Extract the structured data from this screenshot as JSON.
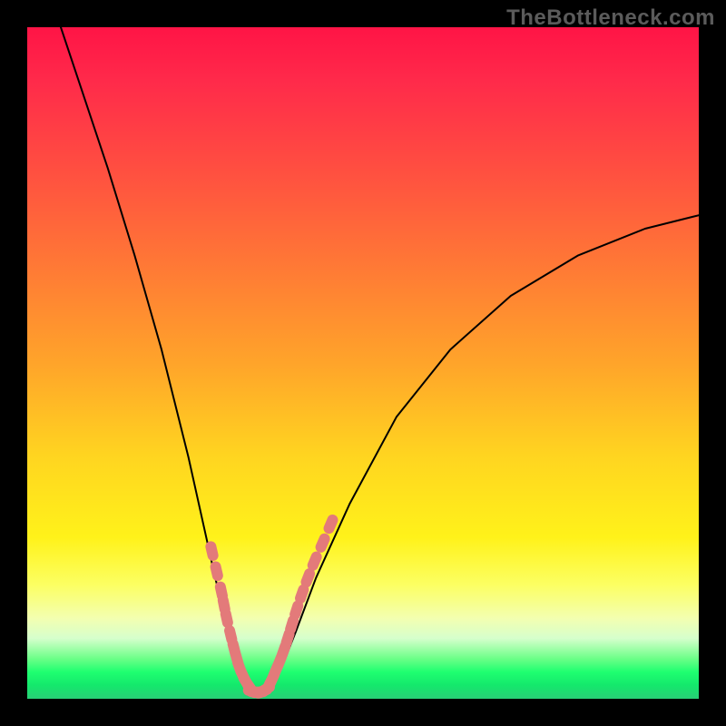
{
  "watermark": "TheBottleneck.com",
  "chart_data": {
    "type": "line",
    "title": "",
    "xlabel": "",
    "ylabel": "",
    "xlim": [
      0,
      100
    ],
    "ylim": [
      0,
      100
    ],
    "grid": false,
    "legend": false,
    "annotations": [],
    "series": [
      {
        "name": "curve",
        "color": "#000000",
        "x": [
          5,
          8,
          12,
          16,
          20,
          24,
          26,
          28,
          30,
          31,
          32,
          33,
          34,
          35,
          36,
          37,
          38,
          40,
          43,
          48,
          55,
          63,
          72,
          82,
          92,
          100
        ],
        "y": [
          100,
          91,
          79,
          66,
          52,
          36,
          27,
          18,
          10,
          6,
          3,
          1.5,
          1,
          1,
          1.5,
          3,
          5,
          10,
          18,
          29,
          42,
          52,
          60,
          66,
          70,
          72
        ]
      },
      {
        "name": "marker-band-left",
        "color": "#e37a7a",
        "type": "scatter",
        "x": [
          27.5,
          28.2,
          28.9,
          29.3,
          29.7,
          30.3,
          30.8,
          31.2,
          31.6,
          32.1,
          32.6,
          33.2
        ],
        "y": [
          22,
          19,
          16,
          14,
          12,
          9.5,
          7.5,
          6,
          4.7,
          3.5,
          2.5,
          1.6
        ]
      },
      {
        "name": "marker-band-right",
        "color": "#e37a7a",
        "type": "scatter",
        "x": [
          36.0,
          36.5,
          37.0,
          37.6,
          38.2,
          38.8,
          39.4,
          40.1,
          40.9,
          41.8,
          42.8,
          44.0,
          45.2
        ],
        "y": [
          2.0,
          3.0,
          4.2,
          5.6,
          7.2,
          9.0,
          11.0,
          13.2,
          15.6,
          18.0,
          20.5,
          23.2,
          26.0
        ]
      },
      {
        "name": "marker-band-bottom",
        "color": "#e37a7a",
        "type": "scatter",
        "x": [
          33.6,
          34.0,
          34.5,
          35.0,
          35.5
        ],
        "y": [
          1.1,
          1.0,
          1.0,
          1.1,
          1.4
        ]
      }
    ],
    "background_gradient": {
      "direction": "top-to-bottom",
      "stops": [
        {
          "pos": 0.0,
          "color": "#ff1446"
        },
        {
          "pos": 0.36,
          "color": "#ff7a35"
        },
        {
          "pos": 0.64,
          "color": "#ffd520"
        },
        {
          "pos": 0.88,
          "color": "#f3ffb0"
        },
        {
          "pos": 0.96,
          "color": "#1fff70"
        },
        {
          "pos": 1.0,
          "color": "#28cf76"
        }
      ]
    }
  }
}
